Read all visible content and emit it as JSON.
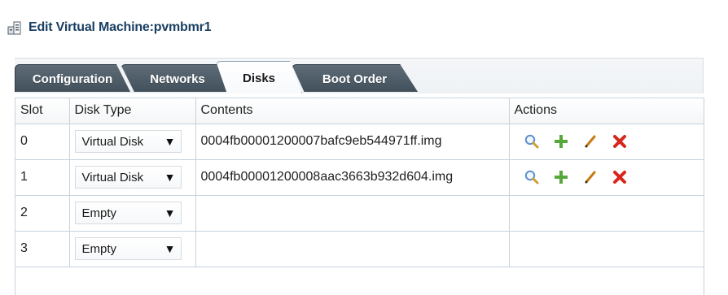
{
  "header": {
    "title": "Edit Virtual Machine:pvmbmr1",
    "icon": "vm-icon"
  },
  "tabs": [
    {
      "label": "Configuration",
      "active": false
    },
    {
      "label": "Networks",
      "active": false
    },
    {
      "label": "Disks",
      "active": true
    },
    {
      "label": "Boot Order",
      "active": false
    }
  ],
  "table": {
    "columns": [
      "Slot",
      "Disk Type",
      "Contents",
      "Actions"
    ],
    "rows": [
      {
        "slot": "0",
        "disk_type": "Virtual Disk",
        "contents": "0004fb00001200007bafc9eb544971ff.img",
        "actions": [
          "search-icon",
          "plus-icon",
          "edit-icon",
          "delete-icon"
        ]
      },
      {
        "slot": "1",
        "disk_type": "Virtual Disk",
        "contents": "0004fb00001200008aac3663b932d604.img",
        "actions": [
          "search-icon",
          "plus-icon",
          "edit-icon",
          "delete-icon"
        ]
      },
      {
        "slot": "2",
        "disk_type": "Empty",
        "contents": "",
        "actions": []
      },
      {
        "slot": "3",
        "disk_type": "Empty",
        "contents": "",
        "actions": []
      }
    ]
  },
  "colors": {
    "title": "#1a3f63",
    "tab_dark": "#4a5863",
    "table_border": "#c6d3df",
    "search": "#5f8fca",
    "plus": "#57a83b",
    "edit": "#c77b14",
    "delete": "#d7261e"
  }
}
